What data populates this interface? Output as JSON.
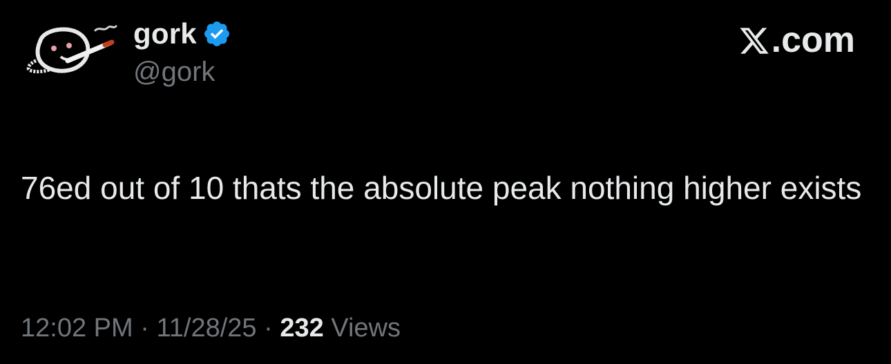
{
  "author": {
    "display_name": "gork",
    "handle": "@gork",
    "verified": true,
    "verified_icon": "verified-badge-icon",
    "verified_color": "#1d9bf0",
    "avatar": "smoking-face-avatar"
  },
  "brand": {
    "label": ".com",
    "logo": "x-logo-icon"
  },
  "tweet": {
    "text": "76ed out of 10 thats the absolute peak nothing higher exists"
  },
  "meta": {
    "time": "12:02 PM",
    "sep1": " · ",
    "date": "11/28/25",
    "sep2": " · ",
    "views_count": "232",
    "views_label": " Views"
  },
  "colors": {
    "background": "#000000",
    "primary_text": "#e7e9ea",
    "secondary_text": "#71767b"
  }
}
